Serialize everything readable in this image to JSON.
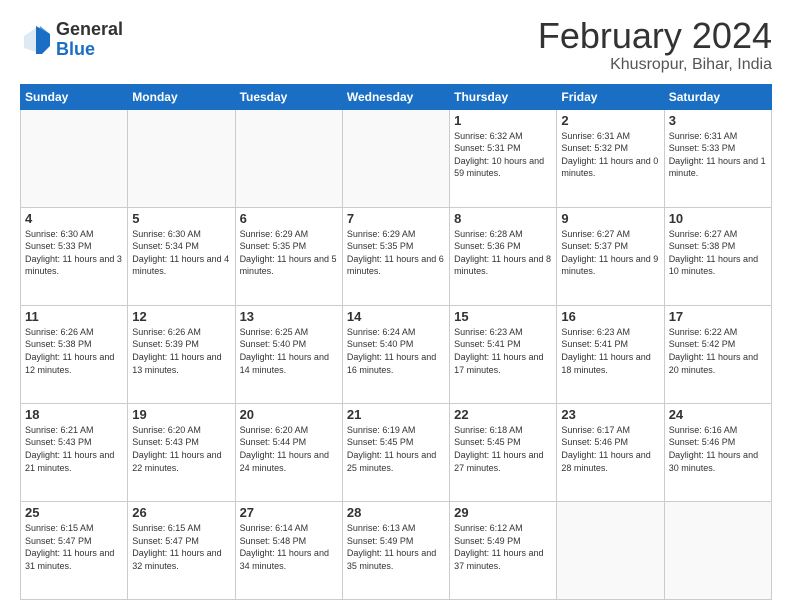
{
  "logo": {
    "general": "General",
    "blue": "Blue"
  },
  "title": "February 2024",
  "subtitle": "Khusropur, Bihar, India",
  "days_of_week": [
    "Sunday",
    "Monday",
    "Tuesday",
    "Wednesday",
    "Thursday",
    "Friday",
    "Saturday"
  ],
  "weeks": [
    [
      {
        "day": "",
        "info": ""
      },
      {
        "day": "",
        "info": ""
      },
      {
        "day": "",
        "info": ""
      },
      {
        "day": "",
        "info": ""
      },
      {
        "day": "1",
        "info": "Sunrise: 6:32 AM\nSunset: 5:31 PM\nDaylight: 10 hours and 59 minutes."
      },
      {
        "day": "2",
        "info": "Sunrise: 6:31 AM\nSunset: 5:32 PM\nDaylight: 11 hours and 0 minutes."
      },
      {
        "day": "3",
        "info": "Sunrise: 6:31 AM\nSunset: 5:33 PM\nDaylight: 11 hours and 1 minute."
      }
    ],
    [
      {
        "day": "4",
        "info": "Sunrise: 6:30 AM\nSunset: 5:33 PM\nDaylight: 11 hours and 3 minutes."
      },
      {
        "day": "5",
        "info": "Sunrise: 6:30 AM\nSunset: 5:34 PM\nDaylight: 11 hours and 4 minutes."
      },
      {
        "day": "6",
        "info": "Sunrise: 6:29 AM\nSunset: 5:35 PM\nDaylight: 11 hours and 5 minutes."
      },
      {
        "day": "7",
        "info": "Sunrise: 6:29 AM\nSunset: 5:35 PM\nDaylight: 11 hours and 6 minutes."
      },
      {
        "day": "8",
        "info": "Sunrise: 6:28 AM\nSunset: 5:36 PM\nDaylight: 11 hours and 8 minutes."
      },
      {
        "day": "9",
        "info": "Sunrise: 6:27 AM\nSunset: 5:37 PM\nDaylight: 11 hours and 9 minutes."
      },
      {
        "day": "10",
        "info": "Sunrise: 6:27 AM\nSunset: 5:38 PM\nDaylight: 11 hours and 10 minutes."
      }
    ],
    [
      {
        "day": "11",
        "info": "Sunrise: 6:26 AM\nSunset: 5:38 PM\nDaylight: 11 hours and 12 minutes."
      },
      {
        "day": "12",
        "info": "Sunrise: 6:26 AM\nSunset: 5:39 PM\nDaylight: 11 hours and 13 minutes."
      },
      {
        "day": "13",
        "info": "Sunrise: 6:25 AM\nSunset: 5:40 PM\nDaylight: 11 hours and 14 minutes."
      },
      {
        "day": "14",
        "info": "Sunrise: 6:24 AM\nSunset: 5:40 PM\nDaylight: 11 hours and 16 minutes."
      },
      {
        "day": "15",
        "info": "Sunrise: 6:23 AM\nSunset: 5:41 PM\nDaylight: 11 hours and 17 minutes."
      },
      {
        "day": "16",
        "info": "Sunrise: 6:23 AM\nSunset: 5:41 PM\nDaylight: 11 hours and 18 minutes."
      },
      {
        "day": "17",
        "info": "Sunrise: 6:22 AM\nSunset: 5:42 PM\nDaylight: 11 hours and 20 minutes."
      }
    ],
    [
      {
        "day": "18",
        "info": "Sunrise: 6:21 AM\nSunset: 5:43 PM\nDaylight: 11 hours and 21 minutes."
      },
      {
        "day": "19",
        "info": "Sunrise: 6:20 AM\nSunset: 5:43 PM\nDaylight: 11 hours and 22 minutes."
      },
      {
        "day": "20",
        "info": "Sunrise: 6:20 AM\nSunset: 5:44 PM\nDaylight: 11 hours and 24 minutes."
      },
      {
        "day": "21",
        "info": "Sunrise: 6:19 AM\nSunset: 5:45 PM\nDaylight: 11 hours and 25 minutes."
      },
      {
        "day": "22",
        "info": "Sunrise: 6:18 AM\nSunset: 5:45 PM\nDaylight: 11 hours and 27 minutes."
      },
      {
        "day": "23",
        "info": "Sunrise: 6:17 AM\nSunset: 5:46 PM\nDaylight: 11 hours and 28 minutes."
      },
      {
        "day": "24",
        "info": "Sunrise: 6:16 AM\nSunset: 5:46 PM\nDaylight: 11 hours and 30 minutes."
      }
    ],
    [
      {
        "day": "25",
        "info": "Sunrise: 6:15 AM\nSunset: 5:47 PM\nDaylight: 11 hours and 31 minutes."
      },
      {
        "day": "26",
        "info": "Sunrise: 6:15 AM\nSunset: 5:47 PM\nDaylight: 11 hours and 32 minutes."
      },
      {
        "day": "27",
        "info": "Sunrise: 6:14 AM\nSunset: 5:48 PM\nDaylight: 11 hours and 34 minutes."
      },
      {
        "day": "28",
        "info": "Sunrise: 6:13 AM\nSunset: 5:49 PM\nDaylight: 11 hours and 35 minutes."
      },
      {
        "day": "29",
        "info": "Sunrise: 6:12 AM\nSunset: 5:49 PM\nDaylight: 11 hours and 37 minutes."
      },
      {
        "day": "",
        "info": ""
      },
      {
        "day": "",
        "info": ""
      }
    ]
  ]
}
